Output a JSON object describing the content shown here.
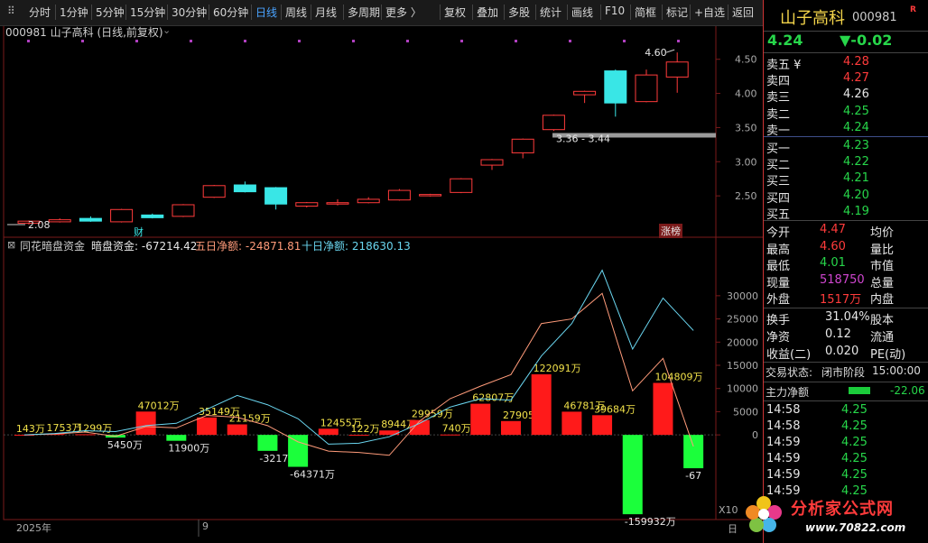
{
  "toolbar": {
    "items": [
      "分时",
      "1分钟",
      "5分钟",
      "15分钟",
      "30分钟",
      "60分钟",
      "日线",
      "周线",
      "月线",
      "多周期",
      "更多 〉",
      "复权",
      "叠加",
      "多股",
      "统计",
      "画线",
      "F10",
      "简框",
      "标记",
      "+自选",
      "返回"
    ],
    "active": "日线"
  },
  "chart": {
    "header": "000981 山子高科 (日线,前复权)",
    "price_axis": [
      "4.50",
      "4.00",
      "3.50",
      "3.00",
      "2.50"
    ],
    "high_label": "4.60",
    "low_label": "2.08",
    "range_label": "3.36 - 3.44",
    "marker_cai": "财",
    "marker_zhang": "涨榜",
    "indicator_name": "同花暗盘资金",
    "indicator_dark": "暗盘资金: -67214.42",
    "indicator_five": "五日净额: -24871.81",
    "indicator_ten": "十日净额: 218630.13",
    "ind_axis": [
      "30000",
      "25000",
      "20000",
      "15000",
      "10000",
      "5000",
      "0"
    ],
    "date_left": "2025年",
    "date_mid": "9",
    "x10": "X10",
    "day_btn": "日",
    "colors": {
      "up": "#ff3b3b",
      "down": "#39e6e6",
      "bar_up": "#ff1a1a",
      "bar_down": "#1bff3b",
      "five": "#ff9b7a",
      "ten": "#6ad6f0"
    }
  },
  "chart_data": {
    "type": "candlestick",
    "ylim": [
      2.0,
      4.8
    ],
    "candles": [
      {
        "o": 2.1,
        "c": 2.13,
        "h": 2.14,
        "l": 2.08
      },
      {
        "o": 2.12,
        "c": 2.15,
        "h": 2.17,
        "l": 2.11
      },
      {
        "o": 2.17,
        "c": 2.13,
        "h": 2.2,
        "l": 2.12
      },
      {
        "o": 2.12,
        "c": 2.3,
        "h": 2.31,
        "l": 2.11
      },
      {
        "o": 2.22,
        "c": 2.18,
        "h": 2.24,
        "l": 2.17
      },
      {
        "o": 2.2,
        "c": 2.37,
        "h": 2.38,
        "l": 2.19
      },
      {
        "o": 2.48,
        "c": 2.65,
        "h": 2.66,
        "l": 2.47
      },
      {
        "o": 2.66,
        "c": 2.56,
        "h": 2.71,
        "l": 2.55
      },
      {
        "o": 2.62,
        "c": 2.38,
        "h": 2.63,
        "l": 2.3
      },
      {
        "o": 2.35,
        "c": 2.4,
        "h": 2.41,
        "l": 2.33
      },
      {
        "o": 2.4,
        "c": 2.4,
        "h": 2.45,
        "l": 2.36
      },
      {
        "o": 2.4,
        "c": 2.45,
        "h": 2.48,
        "l": 2.39
      },
      {
        "o": 2.44,
        "c": 2.58,
        "h": 2.6,
        "l": 2.43
      },
      {
        "o": 2.5,
        "c": 2.52,
        "h": 2.53,
        "l": 2.49
      },
      {
        "o": 2.55,
        "c": 2.75,
        "h": 2.76,
        "l": 2.54
      },
      {
        "o": 2.95,
        "c": 3.03,
        "h": 3.04,
        "l": 2.88
      },
      {
        "o": 3.13,
        "c": 3.33,
        "h": 3.34,
        "l": 3.05
      },
      {
        "o": 3.47,
        "c": 3.68,
        "h": 3.69,
        "l": 3.45
      },
      {
        "o": 3.98,
        "c": 4.03,
        "h": 4.04,
        "l": 3.86
      },
      {
        "o": 4.33,
        "c": 3.86,
        "h": 4.35,
        "l": 3.66
      },
      {
        "o": 3.88,
        "c": 4.27,
        "h": 4.35,
        "l": 3.87
      },
      {
        "o": 4.24,
        "c": 4.46,
        "h": 4.6,
        "l": 4.01
      }
    ],
    "flows": [
      143,
      1753,
      1299,
      -5450,
      47012,
      -11900,
      35149,
      21159,
      -32173,
      -64371,
      12455,
      122,
      8944,
      29959,
      740,
      62807,
      27905,
      122091,
      46781,
      39684,
      -159932,
      104809,
      -67214
    ],
    "flow_labels": [
      "143万",
      "1753万",
      "1299万",
      "5450万",
      "47012万",
      "11900万",
      "35149万",
      "21159万",
      "-32173万",
      "-64371万",
      "12455万",
      "122万",
      "8944万",
      "29959万",
      "740万",
      "62807万",
      "27905万",
      "122091万",
      "46781万",
      "39684万",
      "-159932万",
      "104809万",
      "-67"
    ],
    "five_day": [
      0,
      200,
      600,
      -300,
      1800,
      1500,
      4200,
      3800,
      2000,
      -1500,
      -3500,
      -3800,
      -4400,
      3000,
      7800,
      10500,
      13000,
      24000,
      25000,
      30500,
      9500,
      16500,
      -2500
    ],
    "ten_day": [
      0,
      300,
      900,
      700,
      2000,
      2500,
      5500,
      8500,
      6500,
      3500,
      -2000,
      -1800,
      -400,
      2500,
      6000,
      7800,
      7500,
      17000,
      24000,
      35500,
      18500,
      29500,
      22500
    ],
    "ind_ylim": [
      -16500,
      36000
    ]
  },
  "side": {
    "stock_name": "山子高科",
    "stock_code": "000981",
    "flag": "R",
    "price": "4.24",
    "change": "▼-0.02",
    "asks": [
      [
        "卖五 ¥",
        "4.28"
      ],
      [
        "卖四",
        "4.27"
      ],
      [
        "卖三",
        "4.26"
      ],
      [
        "卖二",
        "4.25"
      ],
      [
        "卖一",
        "4.24"
      ]
    ],
    "bids": [
      [
        "买一",
        "4.23"
      ],
      [
        "买二",
        "4.22"
      ],
      [
        "买三",
        "4.21"
      ],
      [
        "买四",
        "4.20"
      ],
      [
        "买五",
        "4.19"
      ]
    ],
    "stats": [
      [
        "今开",
        "4.47",
        "均价"
      ],
      [
        "最高",
        "4.60",
        "量比"
      ],
      [
        "最低",
        "4.01",
        "市值"
      ],
      [
        "现量",
        "518750",
        "总量"
      ],
      [
        "外盘",
        "1517万",
        "内盘"
      ]
    ],
    "metrics": [
      [
        "换手",
        "31.04%",
        "股本"
      ],
      [
        "净资",
        "0.12",
        "流通"
      ],
      [
        "收益(二)",
        "0.020",
        "PE(动)"
      ]
    ],
    "trade_state_label": "交易状态:",
    "trade_state": "闭市阶段",
    "trade_time": "15:00:00",
    "net_flow_label": "主力净额",
    "net_flow_value": "-22.06",
    "ticks": [
      [
        "14:58",
        "4.25"
      ],
      [
        "14:58",
        "4.25"
      ],
      [
        "14:59",
        "4.25"
      ],
      [
        "14:59",
        "4.25"
      ],
      [
        "14:59",
        "4.25"
      ],
      [
        "14:59",
        "4.25"
      ]
    ],
    "watermark_text": "分析家公式网",
    "watermark_url": "www.70822.com"
  }
}
